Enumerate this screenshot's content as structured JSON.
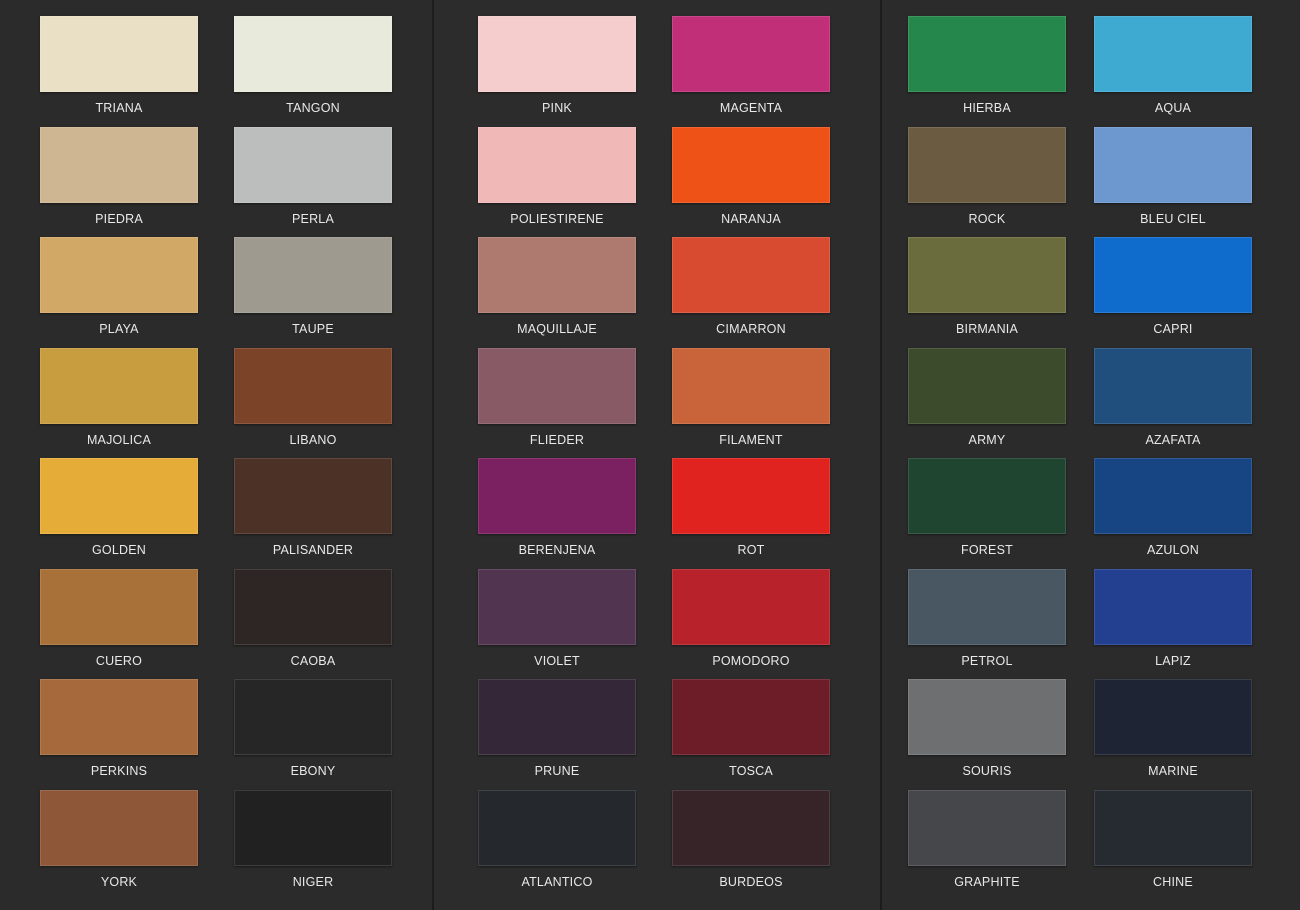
{
  "cards": [
    {
      "swatches": [
        {
          "name": "TRIANA",
          "color": "#eae0c6"
        },
        {
          "name": "TANGON",
          "color": "#e8eadc"
        },
        {
          "name": "PIEDRA",
          "color": "#cdb691"
        },
        {
          "name": "PERLA",
          "color": "#bcbdbd"
        },
        {
          "name": "PLAYA",
          "color": "#d2a866"
        },
        {
          "name": "TAUPE",
          "color": "#9e9a8f"
        },
        {
          "name": "MAJOLICA",
          "color": "#c89d3f"
        },
        {
          "name": "LIBANO",
          "color": "#7b4328"
        },
        {
          "name": "GOLDEN",
          "color": "#e6ac38"
        },
        {
          "name": "PALISANDER",
          "color": "#4c3226"
        },
        {
          "name": "CUERO",
          "color": "#a9713a"
        },
        {
          "name": "CAOBA",
          "color": "#2e2624"
        },
        {
          "name": "PERKINS",
          "color": "#a6693c"
        },
        {
          "name": "EBONY",
          "color": "#262626"
        },
        {
          "name": "YORK",
          "color": "#8d5738"
        },
        {
          "name": "NIGER",
          "color": "#212121"
        }
      ]
    },
    {
      "swatches": [
        {
          "name": "PINK",
          "color": "#f4cdcc"
        },
        {
          "name": "MAGENTA",
          "color": "#c12f79"
        },
        {
          "name": "POLIESTIRENE",
          "color": "#f1b8b8"
        },
        {
          "name": "NARANJA",
          "color": "#ef5217"
        },
        {
          "name": "MAQUILLAJE",
          "color": "#ae7a70"
        },
        {
          "name": "CIMARRON",
          "color": "#d84b31"
        },
        {
          "name": "FLIEDER",
          "color": "#875a66"
        },
        {
          "name": "FILAMENT",
          "color": "#c8633a"
        },
        {
          "name": "BERENJENA",
          "color": "#7b2060"
        },
        {
          "name": "ROT",
          "color": "#e0231e"
        },
        {
          "name": "VIOLET",
          "color": "#513550"
        },
        {
          "name": "POMODORO",
          "color": "#b8222a"
        },
        {
          "name": "PRUNE",
          "color": "#342737"
        },
        {
          "name": "TOSCA",
          "color": "#6c1d27"
        },
        {
          "name": "ATLANTICO",
          "color": "#25292d"
        },
        {
          "name": "BURDEOS",
          "color": "#362428"
        }
      ]
    },
    {
      "swatches": [
        {
          "name": "HIERBA",
          "color": "#26874c"
        },
        {
          "name": "AQUA",
          "color": "#3ea9d1"
        },
        {
          "name": "ROCK",
          "color": "#6b5b40"
        },
        {
          "name": "BLEU CIEL",
          "color": "#6c98cf"
        },
        {
          "name": "BIRMANIA",
          "color": "#6b6c3d"
        },
        {
          "name": "CAPRI",
          "color": "#0f6ccc"
        },
        {
          "name": "ARMY",
          "color": "#3c4b2c"
        },
        {
          "name": "AZAFATA",
          "color": "#214f7d"
        },
        {
          "name": "FOREST",
          "color": "#1f4430"
        },
        {
          "name": "AZULON",
          "color": "#174583"
        },
        {
          "name": "PETROL",
          "color": "#485761"
        },
        {
          "name": "LAPIZ",
          "color": "#233f90"
        },
        {
          "name": "SOURIS",
          "color": "#6e6f70"
        },
        {
          "name": "MARINE",
          "color": "#1e2433"
        },
        {
          "name": "GRAPHITE",
          "color": "#45474a"
        },
        {
          "name": "CHINE",
          "color": "#262b31"
        }
      ]
    }
  ]
}
